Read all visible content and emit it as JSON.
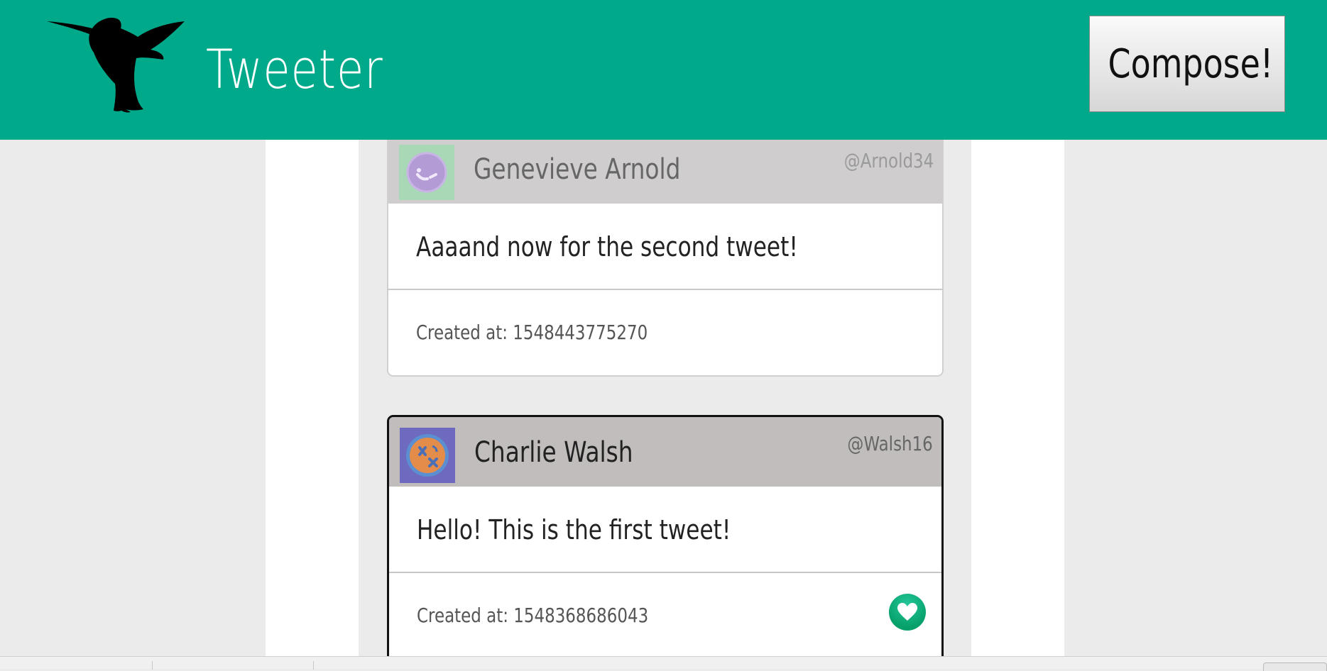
{
  "header": {
    "app_title": "Tweeter",
    "compose_label": "Compose!",
    "logo_icon": "hummingbird-icon",
    "background_color": "#01a98b"
  },
  "tweets": [
    {
      "name": "Genevieve Arnold",
      "handle": "@Arnold34",
      "text": "Aaaand now for the second tweet!",
      "created": "Created at: 1548443775270",
      "avatar_icon": "purple-avatar-icon"
    },
    {
      "name": "Charlie Walsh",
      "handle": "@Walsh16",
      "text": "Hello! This is the first tweet!",
      "created": "Created at: 1548368686043",
      "avatar_icon": "orange-avatar-icon",
      "like_icon": "heart-icon",
      "like_color": "#06a06a"
    }
  ]
}
